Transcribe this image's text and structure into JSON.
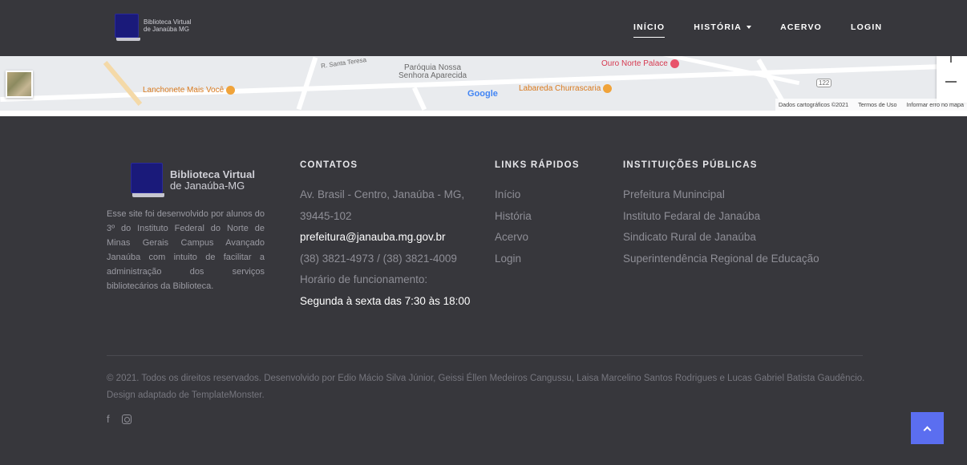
{
  "header": {
    "logo": {
      "line1": "Biblioteca Virtual",
      "line2": "de Janaúba MG"
    },
    "nav": [
      {
        "label": "INÍCIO"
      },
      {
        "label": "HISTÓRIA"
      },
      {
        "label": "ACERVO"
      },
      {
        "label": "LOGIN"
      }
    ]
  },
  "map": {
    "labels": {
      "parish": "Paróquia Nossa\nSenhora Aparecida",
      "lanchonete": "Lanchonete Mais Você",
      "labareda": "Labareda Churrascaria",
      "ouro_norte": "Ouro Norte Palace",
      "santa_teresa": "R. Santa Teresa",
      "google": "Google",
      "route": "122"
    },
    "footer": {
      "data": "Dados cartográficos ©2021",
      "terms": "Termos de Uso",
      "report": "Informar erro no mapa"
    }
  },
  "footer": {
    "logo": {
      "line1": "Biblioteca Virtual",
      "line2": "de Janaúba-MG"
    },
    "about": "Esse site foi desenvolvido por alunos do 3º do Instituto Federal do Norte de Minas Gerais Campus Avançado Janaúba com intuito de facilitar a administração dos serviços bibliotecários da Biblioteca.",
    "contacts": {
      "title": "CONTATOS",
      "address1": "Av. Brasil - Centro, Janaúba - MG,",
      "address2": "39445-102",
      "email": "prefeitura@janauba.mg.gov.br",
      "phone": "(38) 3821-4973 / (38) 3821-4009",
      "hours_label": "Horário de funcionamento:",
      "hours": "Segunda à sexta das 7:30 às 18:00"
    },
    "quick_links": {
      "title": "LINKS RÁPIDOS",
      "items": [
        "Início",
        "História",
        "Acervo",
        "Login"
      ]
    },
    "institutions": {
      "title": "INSTITUIÇÕES PÚBLICAS",
      "items": [
        "Prefeitura Munincipal",
        "Instituto Fedaral de Janaúba",
        "Sindicato Rural de Janaúba",
        "Superintendência Regional de Educação"
      ]
    },
    "copyright": "© 2021. Todos os direitos reservados. Desenvolvido por Edio Mácio Silva Júnior, Geissi Éllen Medeiros Cangussu, Laisa Marcelino Santos Rodrigues e Lucas Gabriel Batista Gaudêncio. Design adaptado de TemplateMonster."
  },
  "colors": {
    "background": "#37373c",
    "accent": "#5b6ef0"
  },
  "icons": [
    "facebook-icon",
    "instagram-icon",
    "chevron-up-icon"
  ]
}
